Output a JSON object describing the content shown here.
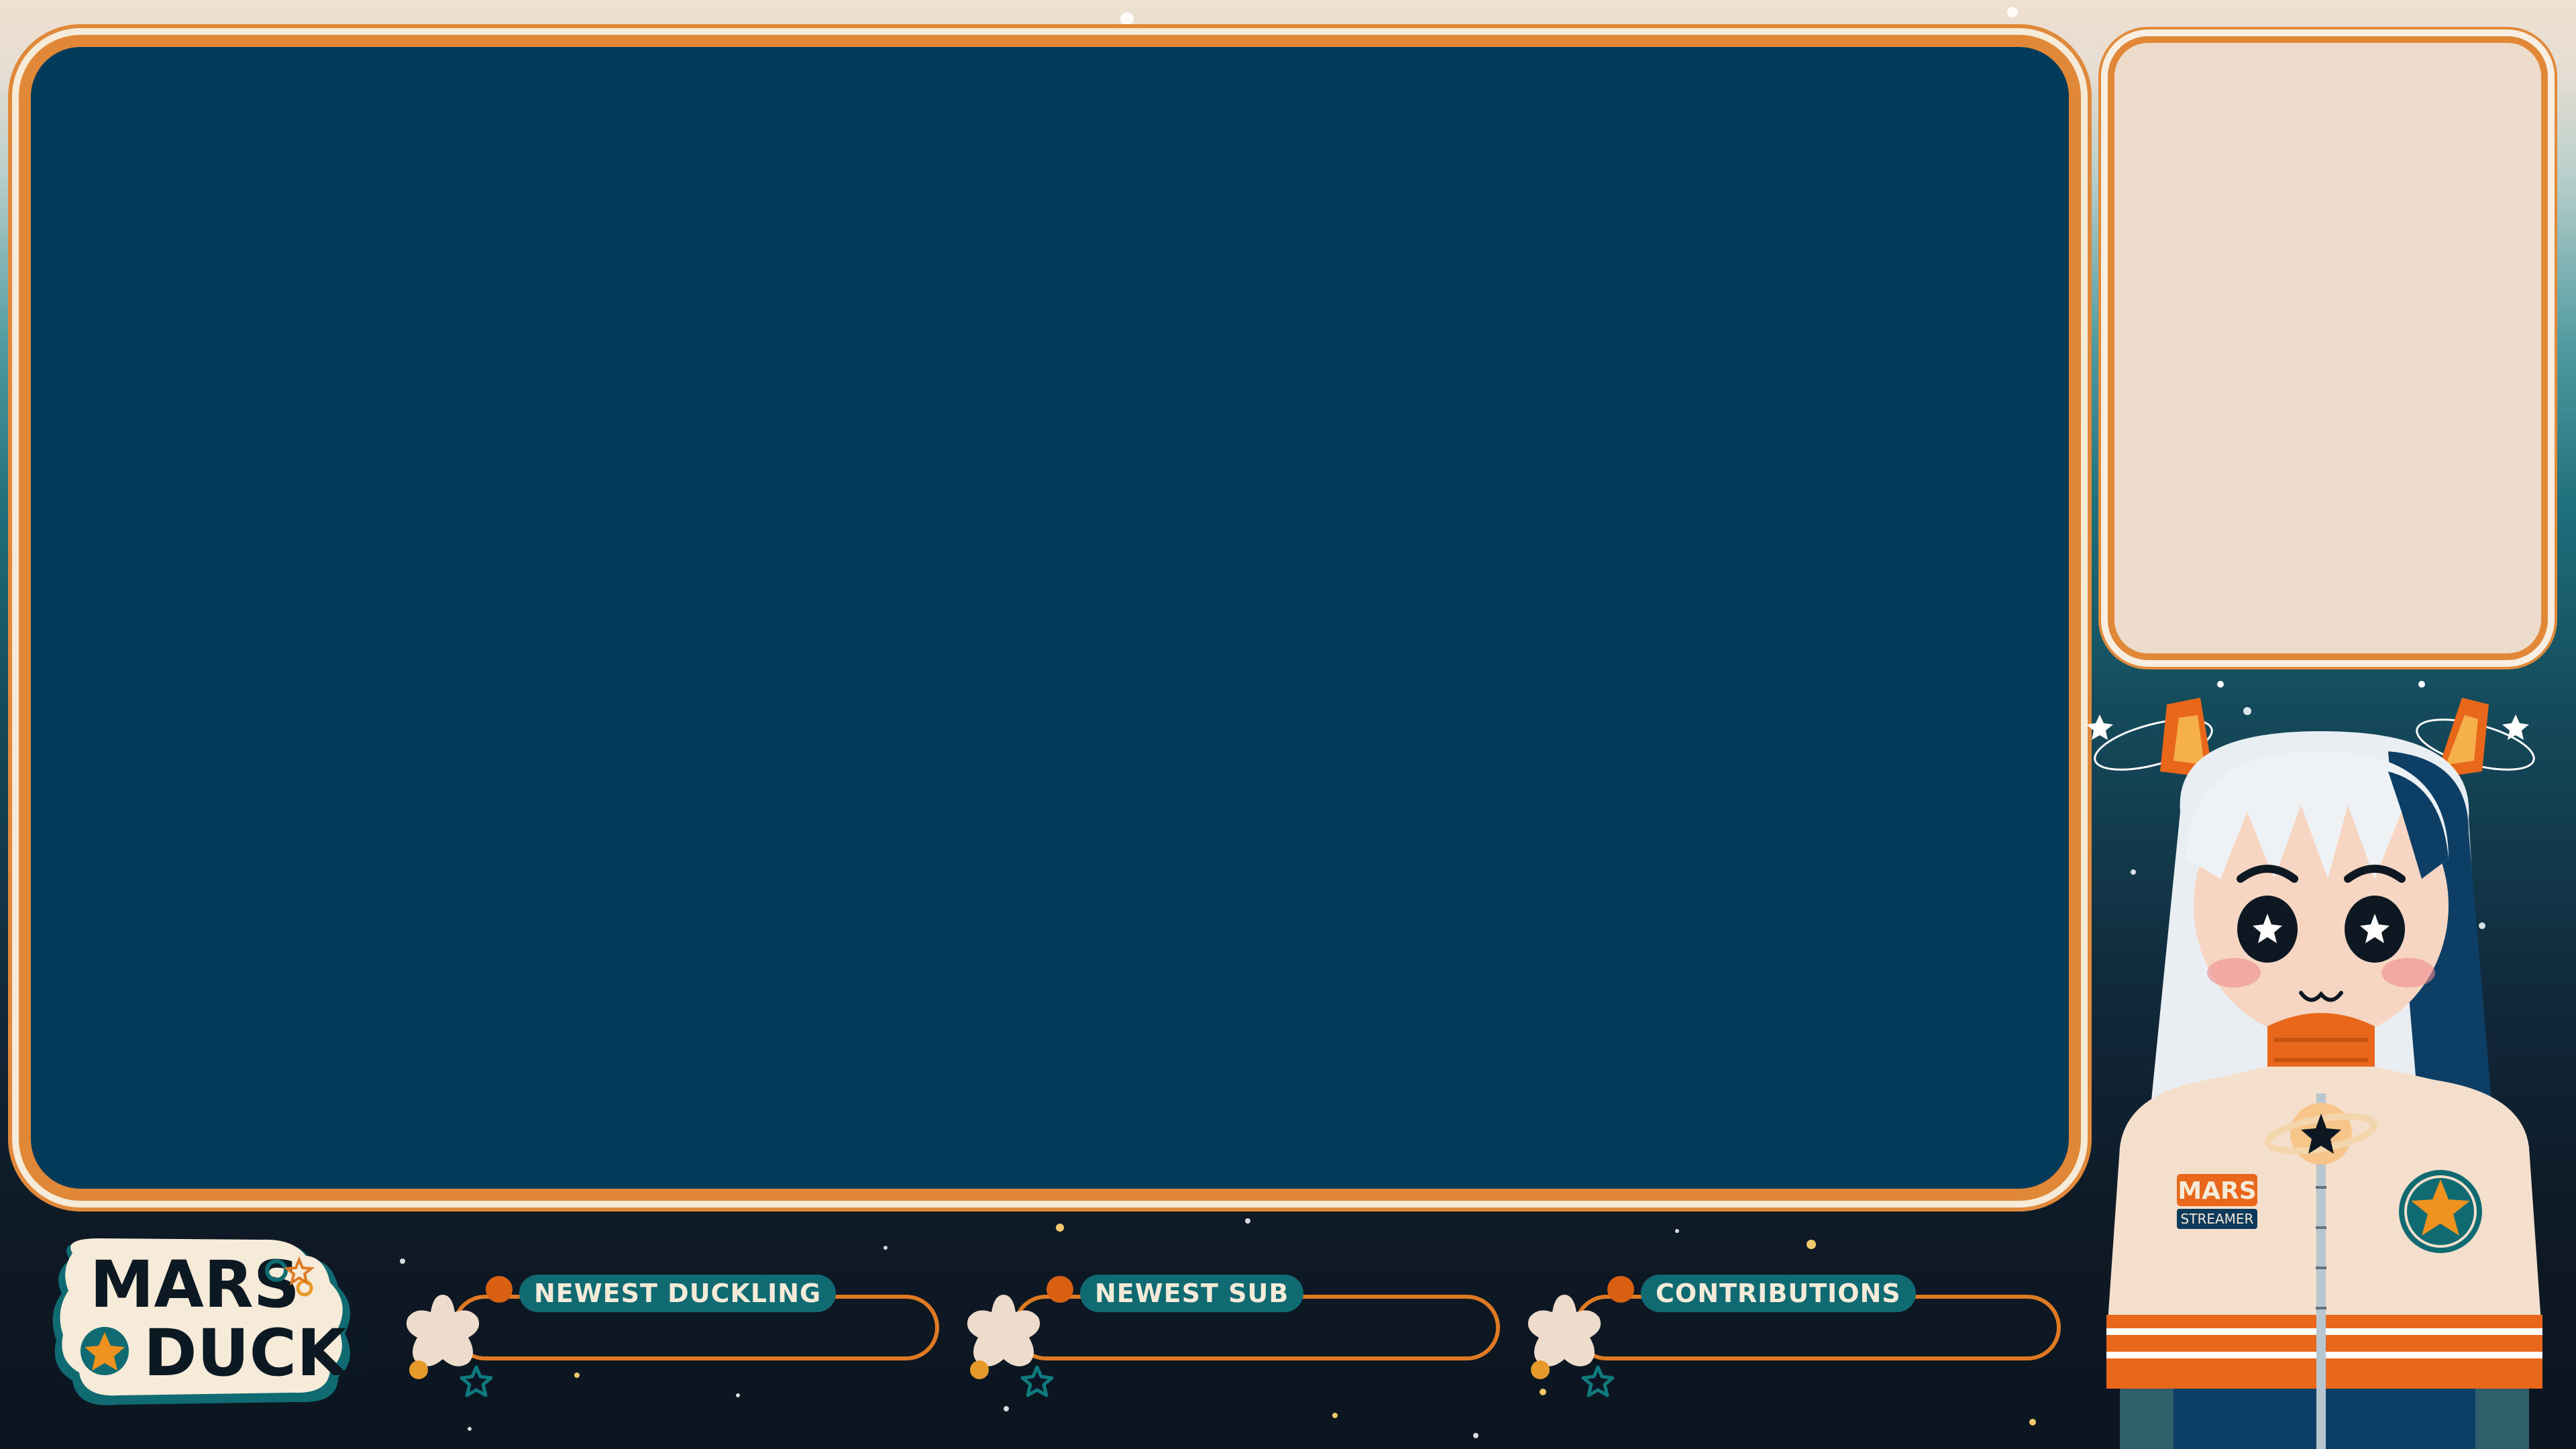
{
  "brand": {
    "logo_line1": "MARS",
    "logo_line2": "DUCKS"
  },
  "panels": [
    {
      "label": "NEWEST DUCKLING"
    },
    {
      "label": "NEWEST SUB"
    },
    {
      "label": "CONTRIBUTIONS"
    }
  ],
  "mascot": {
    "badge_title": "MARS",
    "badge_subtitle": "STREAMER"
  },
  "colors": {
    "accent_orange": "#e08838",
    "game_area": "#023a5a",
    "cream": "#eddbcb",
    "label_teal": "#0f6a72",
    "panel_fill": "#0d1822"
  },
  "icons": [
    "star-icon",
    "star-outline-icon",
    "star-badge-icon",
    "planet-icon"
  ]
}
